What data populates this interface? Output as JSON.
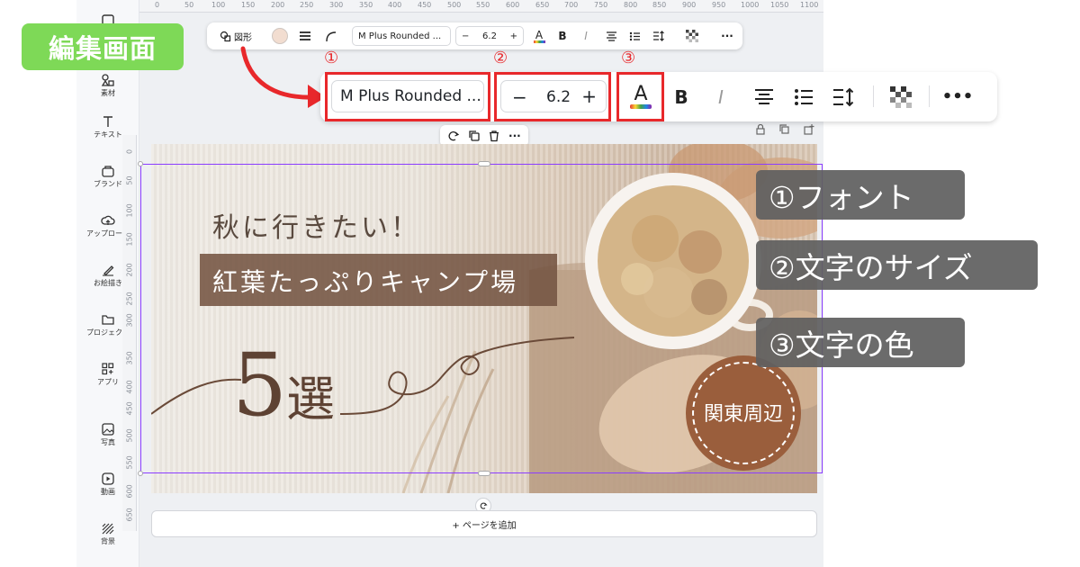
{
  "annotation_badge": "編集画面",
  "sidebar": {
    "items": [
      {
        "label": "素材",
        "icon": "elements-icon"
      },
      {
        "label": "テキスト",
        "icon": "text-icon"
      },
      {
        "label": "ブランド",
        "icon": "brand-icon"
      },
      {
        "label": "アップロード",
        "icon": "upload-icon"
      },
      {
        "label": "お絵描き",
        "icon": "draw-icon"
      },
      {
        "label": "プロジェクト",
        "icon": "folder-icon"
      },
      {
        "label": "アプリ",
        "icon": "apps-icon"
      },
      {
        "label": "写真",
        "icon": "photo-icon"
      },
      {
        "label": "動画",
        "icon": "video-icon"
      },
      {
        "label": "背景",
        "icon": "background-icon"
      }
    ]
  },
  "ruler": {
    "top_ticks": [
      "0",
      "50",
      "100",
      "150",
      "200",
      "250",
      "300",
      "350",
      "400",
      "450",
      "500",
      "550",
      "600",
      "650",
      "700",
      "750",
      "800",
      "850",
      "900",
      "950",
      "1000",
      "1050",
      "1100"
    ],
    "left_ticks": [
      "0",
      "50",
      "100",
      "150",
      "200",
      "250",
      "300",
      "350",
      "400",
      "450",
      "500",
      "550",
      "600",
      "650"
    ]
  },
  "small_toolbar": {
    "shape_label": "図形",
    "font": "M Plus Rounded ...",
    "size": "6.2",
    "minus": "−",
    "plus": "+",
    "bold": "B",
    "italic": "I",
    "more": "···",
    "fill_color": "#f2ddd0"
  },
  "big_toolbar": {
    "font": "M Plus Rounded ...",
    "size": "6.2",
    "minus": "−",
    "plus": "+",
    "text_color_letter": "A",
    "bold": "B",
    "italic": "I",
    "more": "•••"
  },
  "markers": {
    "m1": "①",
    "m2": "②",
    "m3": "③"
  },
  "design": {
    "line1": "秋に行きたい！",
    "line2": "紅葉たっぷりキャンプ場",
    "number": "5",
    "count_word": "選",
    "seal": "関東周辺",
    "band_color": "#745442",
    "seal_color": "#9a5e3c",
    "text_color": "#5e4233"
  },
  "callouts": {
    "c1": "①フォント",
    "c2": "②文字のサイズ",
    "c3": "③文字の色"
  },
  "add_page_label": "+ ページを追加",
  "colors": {
    "accent": "#8b3dff",
    "highlight": "#e8282b",
    "badge": "#7ed957"
  }
}
